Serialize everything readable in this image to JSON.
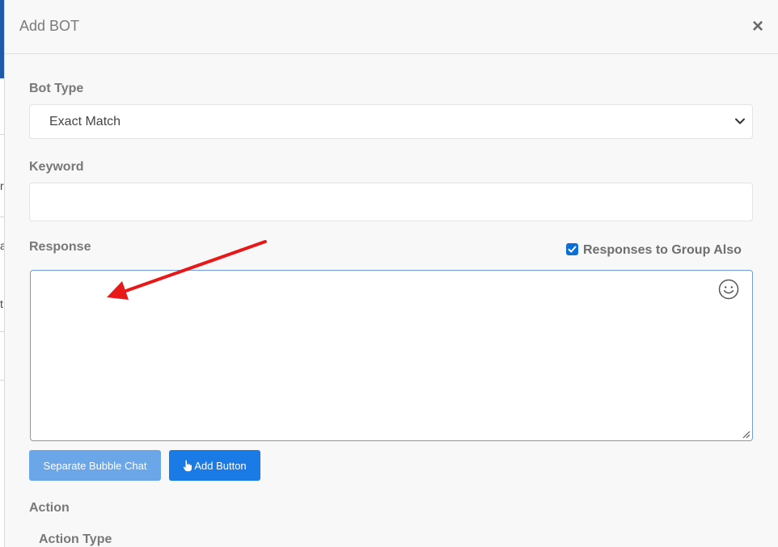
{
  "modal": {
    "title": "Add BOT",
    "close_glyph": "×"
  },
  "form": {
    "bot_type_label": "Bot Type",
    "bot_type_value": "Exact Match",
    "keyword_label": "Keyword",
    "keyword_value": "",
    "response_label": "Response",
    "response_value": "",
    "group_checkbox_label": "Responses to Group Also",
    "group_checkbox_checked": true,
    "action_label": "Action",
    "action_type_label": "Action Type"
  },
  "buttons": {
    "separate_bubble_label": "Separate Bubble Chat",
    "add_button_label": "Add Button"
  },
  "background_page": {
    "visible_chars": [
      "r",
      "a",
      "t"
    ]
  },
  "icons": {
    "close": "close-icon",
    "select": "chevron-down-icon",
    "checkbox": "checkmark-icon",
    "emoji": "smiley-icon",
    "add_button": "hand-pointer-icon",
    "resize": "resize-handle-icon",
    "annotation": "red-arrow-icon"
  },
  "colors": {
    "primary_button": "#1a7ae6",
    "secondary_button": "#6aa6e8",
    "checkbox": "#0b6fd6",
    "focus_border": "#6c9fd6",
    "annotation_arrow": "#e81818"
  }
}
